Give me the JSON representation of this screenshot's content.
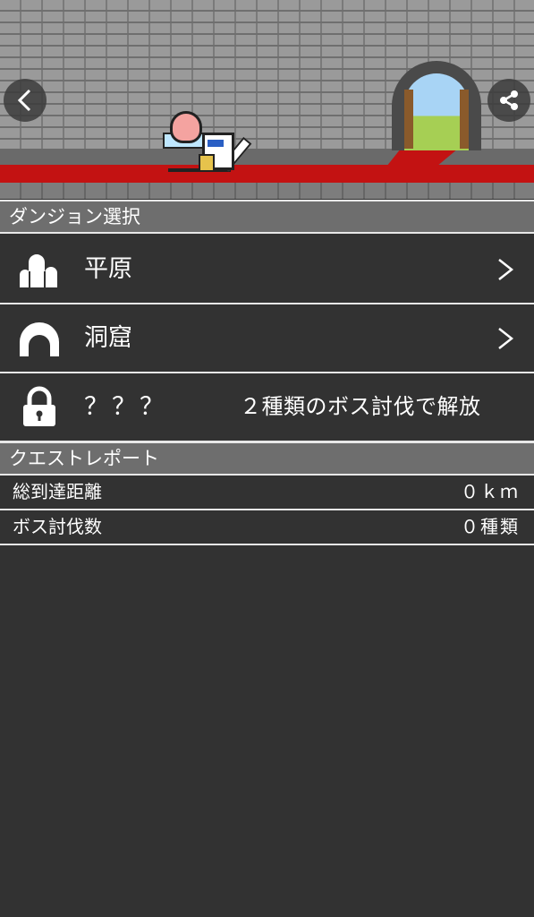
{
  "header": {
    "back_icon": "chevron-left-icon",
    "share_icon": "share-icon"
  },
  "dungeon_select": {
    "title": "ダンジョン選択",
    "items": [
      {
        "label": "平原",
        "icon": "plains-icon",
        "locked": false
      },
      {
        "label": "洞窟",
        "icon": "cave-icon",
        "locked": false
      },
      {
        "label": "？？？",
        "icon": "lock-icon",
        "locked": true,
        "unlock_note": "２種類のボス討伐で解放"
      }
    ]
  },
  "quest_report": {
    "title": "クエストレポート",
    "stats": [
      {
        "label": "総到達距離",
        "value": "０ｋｍ"
      },
      {
        "label": "ボス討伐数",
        "value": "０種類"
      }
    ]
  },
  "colors": {
    "background": "#323232",
    "section_header": "#6e6e6e",
    "divider": "#e8e8e8",
    "carpet": "#c31212"
  }
}
